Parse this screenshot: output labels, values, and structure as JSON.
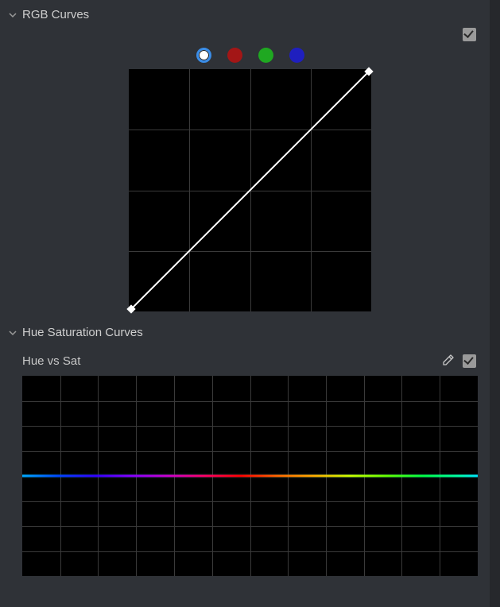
{
  "sections": {
    "rgb": {
      "title": "RGB Curves",
      "enabled": true,
      "channels": {
        "labels": [
          "white",
          "red",
          "green",
          "blue"
        ],
        "colors": [
          "#ffffff",
          "#a31616",
          "#1fa821",
          "#1f1fbf"
        ],
        "active_index": 0
      },
      "grid_divisions": 4,
      "curve": {
        "type": "linear",
        "points": [
          [
            0,
            0
          ],
          [
            1,
            1
          ]
        ]
      }
    },
    "hsc": {
      "title": "Hue Saturation Curves",
      "subsection": {
        "label": "Hue vs Sat",
        "enabled": true,
        "grid_cols": 12,
        "grid_rows": 8
      }
    }
  }
}
